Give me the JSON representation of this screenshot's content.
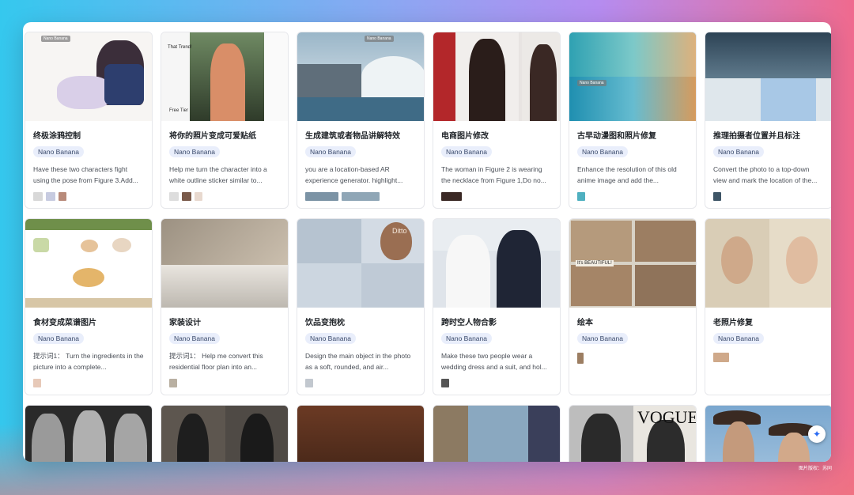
{
  "tag_label": "Nano Banana",
  "thumb_badge": "Nano Banana",
  "credit": "图片版权：苏同",
  "cards": [
    {
      "title": "终极涂鸦控制",
      "desc": "Have these two characters fight using the pose from Figure 3.Add..."
    },
    {
      "title": "将你的照片变成可爱贴纸",
      "desc": "Help me turn the character into a white outline sticker similar to..."
    },
    {
      "title": "生成建筑或者物品讲解特效",
      "desc": "you are a location-based AR experience generator. highlight..."
    },
    {
      "title": "电商图片修改",
      "desc": "The woman in Figure 2 is wearing the necklace from Figure 1,Do no..."
    },
    {
      "title": "古早动漫图和照片修复",
      "desc": "Enhance the resolution of this old anime image and add the..."
    },
    {
      "title": "推理拍摄者位置并且标注",
      "desc": "Convert the photo to a top-down view and mark the location of the..."
    },
    {
      "title": "食材变成菜谱图片",
      "desc": "提示词1： Turn the ingredients in the picture into a complete..."
    },
    {
      "title": "家装设计",
      "desc": "提示词1： Help me convert this residential floor plan into an..."
    },
    {
      "title": "饮品变抱枕",
      "desc": "Design the main object in the photo as a soft, rounded, and air..."
    },
    {
      "title": "跨时空人物合影",
      "desc": "Make these two people wear a wedding dress and a suit, and hol..."
    },
    {
      "title": "绘本",
      "desc": ""
    },
    {
      "title": "老照片修复",
      "desc": ""
    }
  ],
  "thumb_text": {
    "sticker_top": "That Trend!",
    "sticker_free": "Free Tier",
    "ditto": "Ditto",
    "comic": "It's BEAUTIFUL!",
    "vogue": "VOGUE"
  },
  "icons": {
    "fab": "sparkle-icon"
  }
}
